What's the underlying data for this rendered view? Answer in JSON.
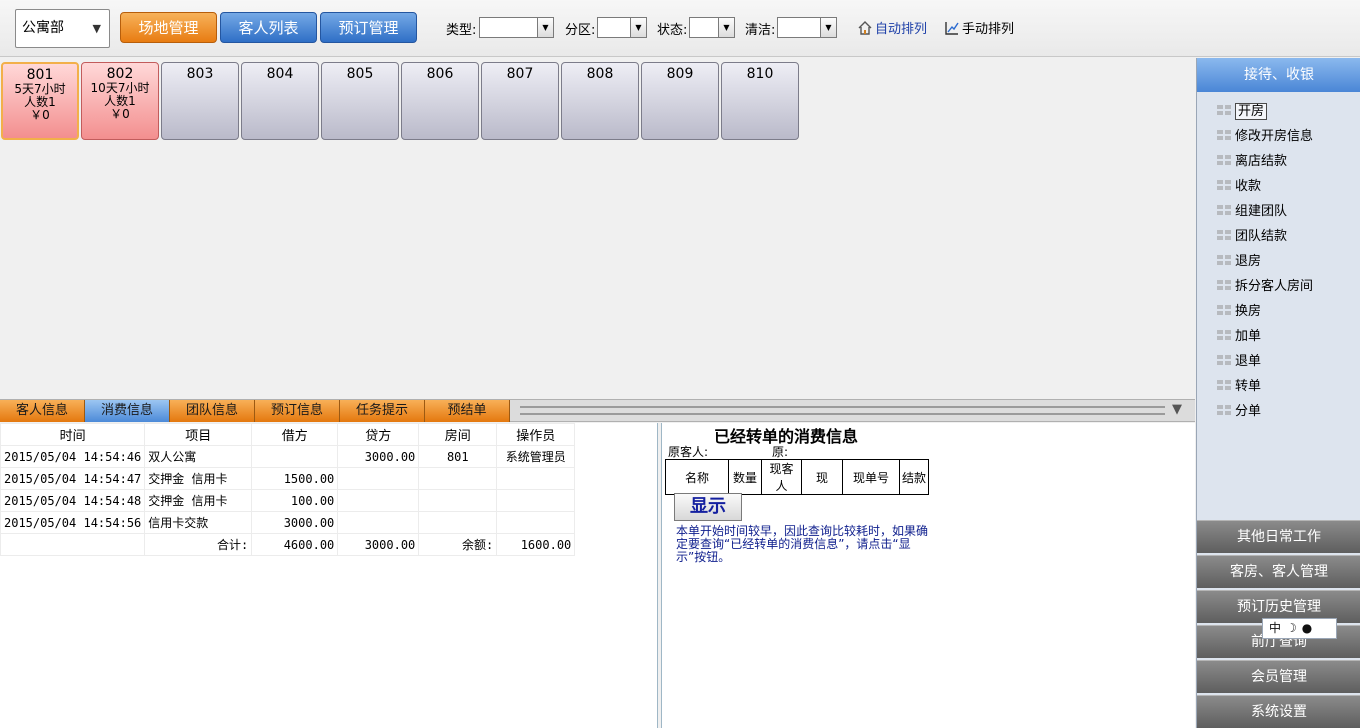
{
  "toolbar": {
    "department": "公寓部",
    "buttons": [
      "场地管理",
      "客人列表",
      "预订管理"
    ],
    "filters": {
      "type_label": "类型:",
      "zone_label": "分区:",
      "status_label": "状态:",
      "clean_label": "清洁:"
    },
    "auto_sort": "自动排列",
    "manual_sort": "手动排列"
  },
  "rooms": [
    {
      "no": "801",
      "line1": "5天7小时",
      "line2": "人数1",
      "line3": "￥0"
    },
    {
      "no": "802",
      "line1": "10天7小时",
      "line2": "人数1",
      "line3": "￥0"
    },
    {
      "no": "803"
    },
    {
      "no": "804"
    },
    {
      "no": "805"
    },
    {
      "no": "806"
    },
    {
      "no": "807"
    },
    {
      "no": "808"
    },
    {
      "no": "809"
    },
    {
      "no": "810"
    }
  ],
  "tabs": [
    "客人信息",
    "消费信息",
    "团队信息",
    "预订信息",
    "任务提示",
    "预结单"
  ],
  "consumption": {
    "headers": [
      "时间",
      "项目",
      "借方",
      "贷方",
      "房间",
      "操作员"
    ],
    "rows": [
      [
        "2015/05/04 14:54:46",
        "双人公寓",
        "",
        "3000.00",
        "801",
        "系统管理员"
      ],
      [
        "2015/05/04 14:54:47",
        "交押金 信用卡",
        "1500.00",
        "",
        "",
        ""
      ],
      [
        "2015/05/04 14:54:48",
        "交押金 信用卡",
        "100.00",
        "",
        "",
        ""
      ],
      [
        "2015/05/04 14:54:56",
        "信用卡交款",
        "3000.00",
        "",
        "",
        ""
      ]
    ],
    "total": {
      "label": "合计:",
      "debit": "4600.00",
      "credit": "3000.00",
      "balance_label": "余额:",
      "balance": "1600.00"
    }
  },
  "transfer": {
    "title": "已经转单的消费信息",
    "orig_guest": "原客人:",
    "orig": "原:",
    "headers": [
      "名称",
      "数量",
      "现客人",
      "现",
      "现单号",
      "结款"
    ],
    "show_button": "显示",
    "note": "本单开始时间较早，因此查询比较耗时，如果确定要查询“已经转单的消费信息”，请点击“显示”按钮。"
  },
  "sidebar": {
    "header": "接待、收银",
    "items": [
      "开房",
      "修改开房信息",
      "离店结款",
      "收款",
      "组建团队",
      "团队结款",
      "退房",
      "拆分客人房间",
      "换房",
      "加单",
      "退单",
      "转单",
      "分单"
    ],
    "sections": [
      "其他日常工作",
      "客房、客人管理",
      "预订历史管理",
      "前厅查询",
      "会员管理",
      "系统设置"
    ]
  },
  "ime": {
    "mode": "中",
    "moon": "☽",
    "user": "●"
  }
}
